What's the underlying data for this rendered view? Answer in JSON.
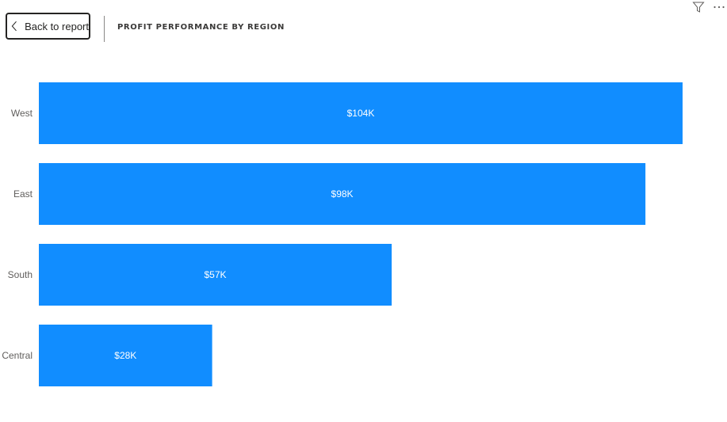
{
  "header": {
    "back_label": "Back to report",
    "title": "PROFIT PERFORMANCE BY REGION"
  },
  "icons": {
    "back": "chevron-left-icon",
    "filter": "filter-icon",
    "more": "more-options-icon"
  },
  "colors": {
    "bar": "#118DFF",
    "bar_label": "#FFFFFF",
    "axis_label": "#605E5C"
  },
  "chart_data": {
    "type": "bar",
    "orientation": "horizontal",
    "categories": [
      "West",
      "East",
      "South",
      "Central"
    ],
    "values": [
      104,
      98,
      57,
      28
    ],
    "labels": [
      "$104K",
      "$98K",
      "$57K",
      "$28K"
    ],
    "title": "PROFIT PERFORMANCE BY REGION",
    "xlabel": "",
    "ylabel": "",
    "xlim": [
      0,
      109
    ],
    "grid": false,
    "legend": "none"
  }
}
